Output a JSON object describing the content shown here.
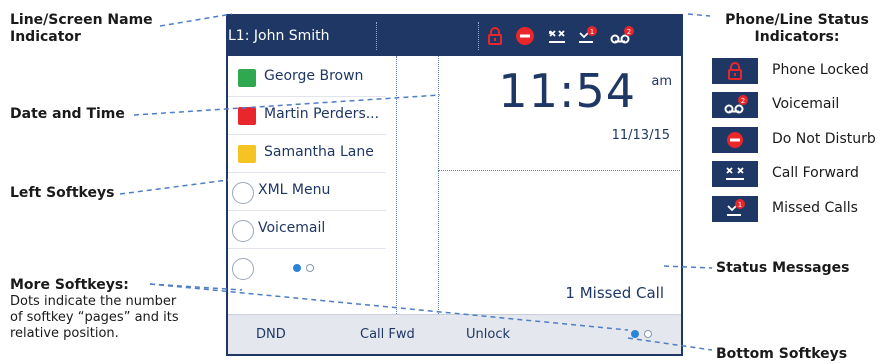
{
  "callouts": {
    "line_name": "Line/Screen Name\nIndicator",
    "date_time": "Date and Time",
    "left_softkeys": "Left Softkeys",
    "more_softkeys": "More Softkeys:",
    "more_softkeys_desc": "Dots indicate the number\nof softkey “pages” and its\nrelative position.",
    "status_indicators": "Phone/Line Status\nIndicators:",
    "status_messages": "Status Messages",
    "bottom_softkeys": "Bottom Softkeys"
  },
  "screen": {
    "line_label": "L1: John Smith",
    "softkeys": [
      {
        "label": "George Brown",
        "type": "square",
        "color": "#2fa84f"
      },
      {
        "label": "Martin Perders...",
        "type": "square",
        "color": "#e8262c"
      },
      {
        "label": "Samantha Lane",
        "type": "square",
        "color": "#f5c322"
      },
      {
        "label": "XML Menu",
        "type": "circle"
      },
      {
        "label": "Voicemail",
        "type": "circle"
      }
    ],
    "time": "11:54",
    "ampm": "am",
    "date": "11/13/15",
    "status_message": "1  Missed Call",
    "bottom_softkeys": [
      "DND",
      "Call Fwd",
      "Unlock"
    ]
  },
  "legend": [
    {
      "label": "Phone Locked",
      "icon": "lock-icon"
    },
    {
      "label": "Voicemail",
      "icon": "voicemail-icon",
      "badge": "2"
    },
    {
      "label": "Do Not Disturb",
      "icon": "dnd-icon"
    },
    {
      "label": "Call Forward",
      "icon": "call-forward-icon"
    },
    {
      "label": "Missed Calls",
      "icon": "missed-calls-icon",
      "badge": "1"
    }
  ],
  "colors": {
    "screen_blue": "#1f3764",
    "callout_line": "#4f7ec4",
    "icon_red": "#e8262c"
  }
}
